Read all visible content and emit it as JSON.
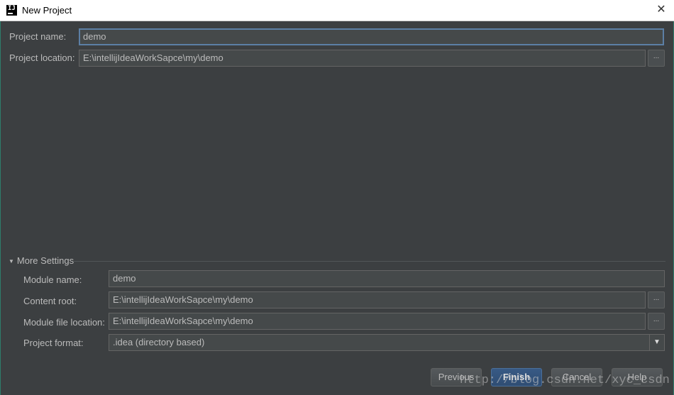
{
  "window": {
    "title": "New Project",
    "app_icon_text": "IJ"
  },
  "project": {
    "name_label": "Project name:",
    "name_value": "demo",
    "location_label": "Project location:",
    "location_value": "E:\\intellijIdeaWorkSapce\\my\\demo",
    "browse_label": "..."
  },
  "more_settings": {
    "header": "More Settings",
    "module_name_label": "Module name:",
    "module_name_value": "demo",
    "content_root_label": "Content root:",
    "content_root_value": "E:\\intellijIdeaWorkSapce\\my\\demo",
    "module_file_location_label": "Module file location:",
    "module_file_location_value": "E:\\intellijIdeaWorkSapce\\my\\demo",
    "project_format_label": "Project format:",
    "project_format_value": ".idea (directory based)"
  },
  "buttons": {
    "previous": "Previous",
    "finish": "Finish",
    "cancel": "Cancel",
    "help": "Help"
  },
  "watermark": "http://blog.csdn.net/xyc_csdn",
  "colors": {
    "background": "#3c3f41",
    "field": "#45494a",
    "focus_border": "#5c7fa5",
    "primary_button": "#365880"
  }
}
